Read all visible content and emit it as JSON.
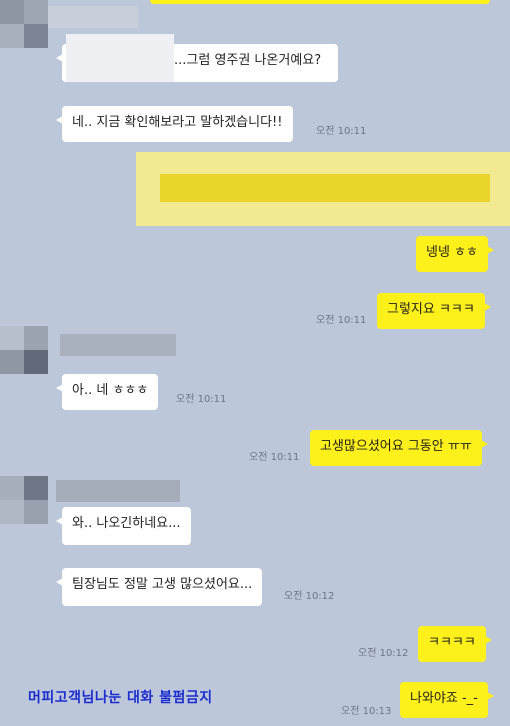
{
  "messages": {
    "m1": "...그럼 영주권 나온거예요?",
    "m2": "네.. 지금 확인해보라고 말하겠습니다!!",
    "m2_time": "오전 10:11",
    "m3": "넹넹 ㅎㅎ",
    "m4": "그렇지요 ㅋㅋㅋ",
    "m4_time": "오전 10:11",
    "m5": "아.. 네 ㅎㅎㅎ",
    "m5_time": "오전 10:11",
    "m6": "고생많으셨어요 그동안 ㅠㅠ",
    "m6_time": "오전 10:11",
    "m7": "와.. 나오긴하네요...",
    "m8": "팀장님도 정말 고생 많으셨어요...",
    "m8_time": "오전 10:12",
    "m9": "ㅋㅋㅋㅋ",
    "m9_time": "오전 10:12",
    "m10": "나와야죠 -_-",
    "m10_time": "오전 10:13"
  },
  "watermark": "머피고객님나눈 대화 불펌금지"
}
